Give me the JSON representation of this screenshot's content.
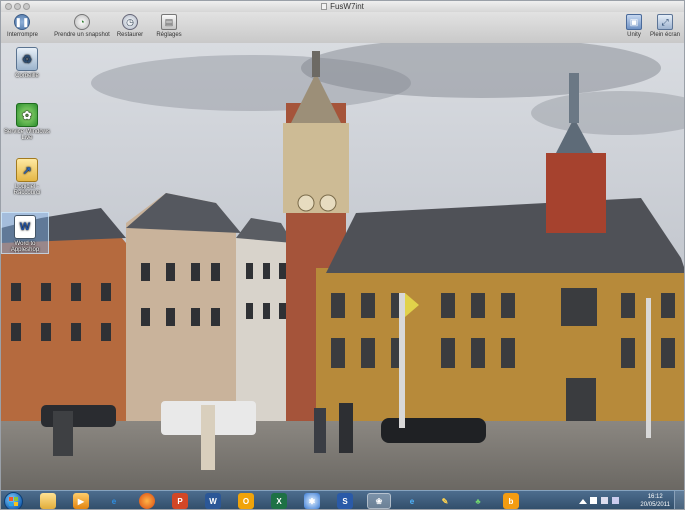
{
  "window": {
    "title": "FusW7int"
  },
  "toolbar": {
    "left_buttons": [
      {
        "label": "Interrompre",
        "icon": "pause-icon"
      },
      {
        "label": "Prendre un snapshot",
        "icon": "snapshot-icon"
      },
      {
        "label": "Restaurer",
        "icon": "restore-icon"
      },
      {
        "label": "Réglages",
        "icon": "settings-icon"
      }
    ],
    "right_buttons": [
      {
        "label": "Unity",
        "icon": "unity-icon"
      },
      {
        "label": "Plein écran",
        "icon": "fullscreen-icon"
      }
    ]
  },
  "desktop_icons": [
    {
      "label": "Corbeille",
      "icon": "recycle-bin-icon"
    },
    {
      "label": "Service Windows Live",
      "icon": "windows-live-icon"
    },
    {
      "label": "Logiciel - Raccourci",
      "icon": "folder-shortcut-icon"
    },
    {
      "label": "Word to Appleshop",
      "icon": "word-doc-icon"
    }
  ],
  "taskbar": {
    "items": [
      "explorer-folder-icon",
      "media-player-icon",
      "internet-explorer-icon",
      "firefox-icon",
      "powerpoint-icon",
      "word-icon",
      "outlook-icon",
      "excel-icon",
      "network-icon",
      "onenote-icon",
      "windows-live-messenger-icon",
      "windows-live-icon",
      "paint-icon",
      "msn-icon",
      "bing-icon"
    ],
    "clock": {
      "time": "16:12",
      "date": "20/05/2011"
    }
  },
  "colors": {
    "taskbar": "#3a5878",
    "toolbar": "#d6d6d6",
    "accent": "#1d64b4"
  }
}
